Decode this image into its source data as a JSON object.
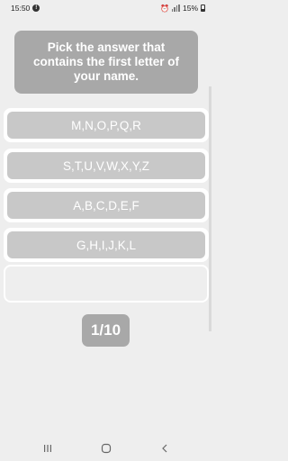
{
  "status_bar": {
    "time": "15:50",
    "notification_glyph": "!",
    "battery_text": "15%"
  },
  "question": {
    "text": "Pick the answer that contains the first letter of your name."
  },
  "answers": [
    {
      "label": "M,N,O,P,Q,R"
    },
    {
      "label": "S,T,U,V,W,X,Y,Z"
    },
    {
      "label": "A,B,C,D,E,F"
    },
    {
      "label": "G,H,I,J,K,L"
    },
    {
      "label": ""
    }
  ],
  "progress": {
    "label": "1/10"
  },
  "icons": {
    "status": [
      "notification-icon",
      "alarm-icon",
      "signal-icon",
      "battery-icon"
    ],
    "nav": [
      "recent-apps-icon",
      "home-icon",
      "back-icon"
    ]
  },
  "colors": {
    "background": "#eeeeee",
    "question_bg": "#a8a8a8",
    "answer_bg": "#c8c8c8",
    "text": "#ffffff"
  }
}
